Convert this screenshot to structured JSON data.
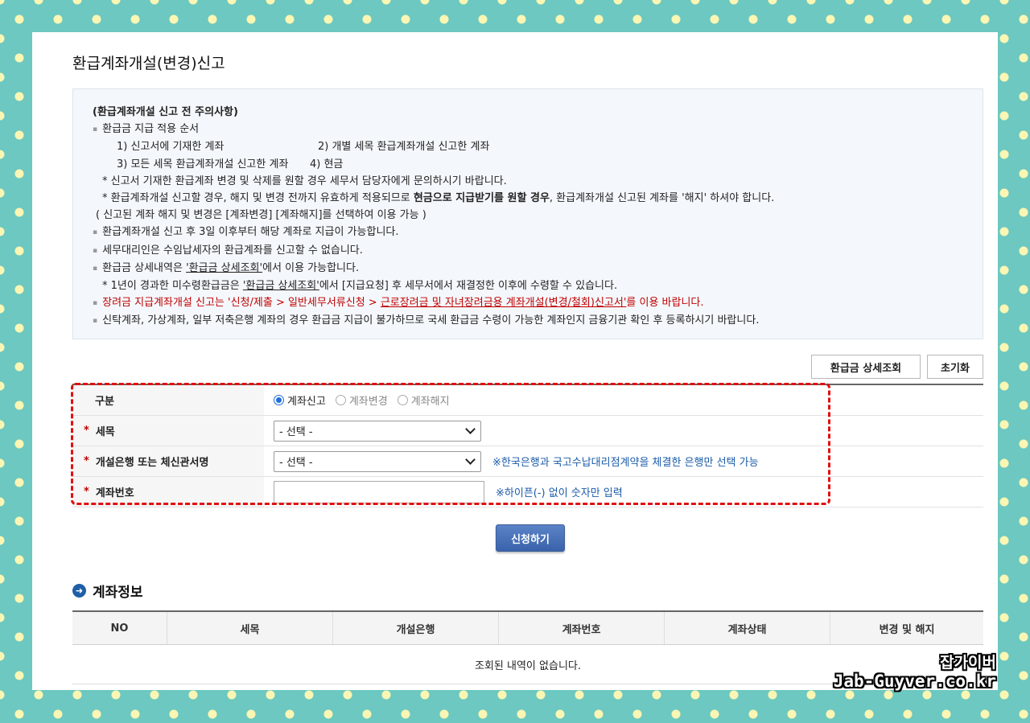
{
  "page": {
    "title": "환급계좌개설(변경)신고"
  },
  "notice": {
    "heading": "(환급계좌개설 신고 전 주의사항)",
    "l1": "환급금 지급 적용 순서",
    "l2a": "1) 신고서에 기재한 계좌",
    "l2b": "2) 개별 세목 환급계좌개설 신고한 계좌",
    "l3a": "3) 모든 세목 환급계좌개설 신고한 계좌",
    "l3b": "4) 현금",
    "l4": "* 신고서 기재한 환급계좌 변경 및 삭제를 원할 경우 세무서 담당자에게 문의하시기 바랍니다.",
    "l5a": "* 환급계좌개설 신고할 경우, 해지 및 변경 전까지 유효하게 적용되므로 ",
    "l5b": "현금으로 지급받기를 원할 경우",
    "l5c": ", 환급계좌개설 신고된 계좌를 '해지' 하셔야 합니다.",
    "l6": "( 신고된 계좌 해지 및 변경은 [계좌변경] [계좌해지]를 선택하여 이용 가능 )",
    "l7": "환급계좌개설 신고 후 3일 이후부터 해당 계좌로 지급이 가능합니다.",
    "l8": "세무대리인은 수임납세자의 환급계좌를 신고할 수 없습니다.",
    "l9a": "환급금 상세내역은 ",
    "l9b": "'환급금 상세조회'",
    "l9c": "에서 이용 가능합니다.",
    "l10a": "* 1년이 경과한 미수령환급금은 ",
    "l10b": "'환급금 상세조회'",
    "l10c": "에서 [지급요청] 후 세무서에서 재결정한 이후에 수령할 수 있습니다.",
    "l11a": "장려금 지급계좌개설 신고는 '신청/제출 > 일반세무서류신청 > ",
    "l11b": "근로장려금 및 자녀장려금용 계좌개설(변경/철회)신고서'",
    "l11c": "를 이용 바랍니다.",
    "l12": "신탁계좌, 가상계좌, 일부 저축은행 계좌의 경우 환급금 지급이 불가하므로 국세 환급금 수령이 가능한 계좌인지 금융기관 확인 후 등록하시기 바랍니다."
  },
  "buttons": {
    "detail": "환급금 상세조회",
    "reset": "초기화",
    "submit": "신청하기"
  },
  "form": {
    "type_label": "구분",
    "type_options": [
      "계좌신고",
      "계좌변경",
      "계좌해지"
    ],
    "tax_label": "세목",
    "tax_value": "- 선택 -",
    "bank_label": "개설은행 또는 체신관서명",
    "bank_value": "- 선택 -",
    "bank_hint": "※한국은행과 국고수납대리점계약을 체결한 은행만 선택 가능",
    "acct_label": "계좌번호",
    "acct_value": "",
    "acct_hint": "※하이픈(-) 없이 숫자만 입력",
    "required_mark": "*"
  },
  "account": {
    "title": "계좌정보",
    "columns": [
      "NO",
      "세목",
      "개설은행",
      "계좌번호",
      "계좌상태",
      "변경 및 해지"
    ],
    "empty": "조회된 내역이 없습니다."
  },
  "watermark": {
    "line1": "잡가이버",
    "line2": "Jab-Guyver.co.kr"
  },
  "colors": {
    "background": "#6cc8c0",
    "dots": "#fbf6b4",
    "highlight": "#e01010",
    "submit": "#3a63ab"
  }
}
